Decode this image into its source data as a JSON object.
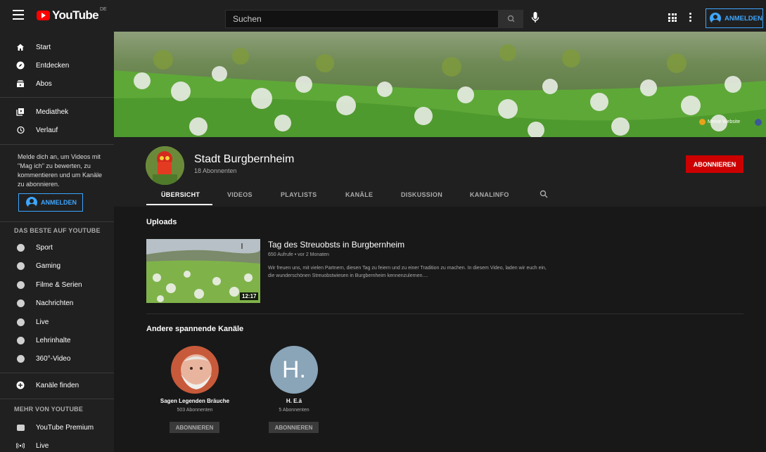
{
  "header": {
    "logo_text": "YouTube",
    "logo_country": "DE",
    "search_placeholder": "Suchen",
    "signin_label": "ANMELDEN"
  },
  "sidebar": {
    "main_items": [
      {
        "label": "Start",
        "icon": "home-icon"
      },
      {
        "label": "Entdecken",
        "icon": "compass-icon"
      },
      {
        "label": "Abos",
        "icon": "subscriptions-icon"
      }
    ],
    "library_items": [
      {
        "label": "Mediathek",
        "icon": "library-icon"
      },
      {
        "label": "Verlauf",
        "icon": "history-icon"
      }
    ],
    "signin_message": "Melde dich an, um Videos mit \"Mag ich\" zu bewerten, zu kommentieren und um Kanäle zu abonnieren.",
    "signin_label": "ANMELDEN",
    "best_of_title": "DAS BESTE AUF YOUTUBE",
    "best_of_items": [
      {
        "label": "Sport",
        "icon": "sport-icon"
      },
      {
        "label": "Gaming",
        "icon": "gaming-icon"
      },
      {
        "label": "Filme & Serien",
        "icon": "movies-icon"
      },
      {
        "label": "Nachrichten",
        "icon": "news-icon"
      },
      {
        "label": "Live",
        "icon": "live-icon"
      },
      {
        "label": "Lehrinhalte",
        "icon": "learning-icon"
      },
      {
        "label": "360°-Video",
        "icon": "vr-icon"
      }
    ],
    "browse_channels_label": "Kanäle finden",
    "more_title": "MEHR VON YOUTUBE",
    "more_items": [
      {
        "label": "YouTube Premium",
        "icon": "youtube-premium-icon"
      },
      {
        "label": "Live",
        "icon": "live-broadcast-icon"
      }
    ]
  },
  "banner": {
    "link_label": "Meine Website"
  },
  "channel": {
    "name": "Stadt Burgbernheim",
    "subscribers": "18 Abonnenten",
    "subscribe_label": "ABONNIEREN",
    "tabs": [
      "ÜBERSICHT",
      "VIDEOS",
      "PLAYLISTS",
      "KANÄLE",
      "DISKUSSION",
      "KANALINFO"
    ],
    "active_tab": "ÜBERSICHT"
  },
  "uploads": {
    "title": "Uploads",
    "video": {
      "title": "Tag des Streuobsts in Burgbernheim",
      "meta": "650 Aufrufe • vor 2 Monaten",
      "description": "Wir freuen uns, mit vielen Partnern, diesen Tag zu feiern und zu einer Tradition zu machen. In diesem Video, laden wir euch ein, die wunderschönen Streuobstwiesen in Burgbernheim kennenzulernen....",
      "duration": "12:17"
    }
  },
  "other_channels": {
    "title": "Andere spannende Kanäle",
    "channels": [
      {
        "name": "Sagen Legenden Bräuche",
        "subscribers": "503 Abonnenten",
        "subscribe_label": "ABONNIEREN"
      },
      {
        "name": "H. E.ä",
        "subscribers": "5 Abonnenten",
        "subscribe_label": "ABONNIEREN",
        "avatar_letter": "H."
      }
    ]
  },
  "colors": {
    "accent_blue": "#3ea6ff",
    "subscribe_red": "#cc0000",
    "brand_red": "#ff0000"
  }
}
